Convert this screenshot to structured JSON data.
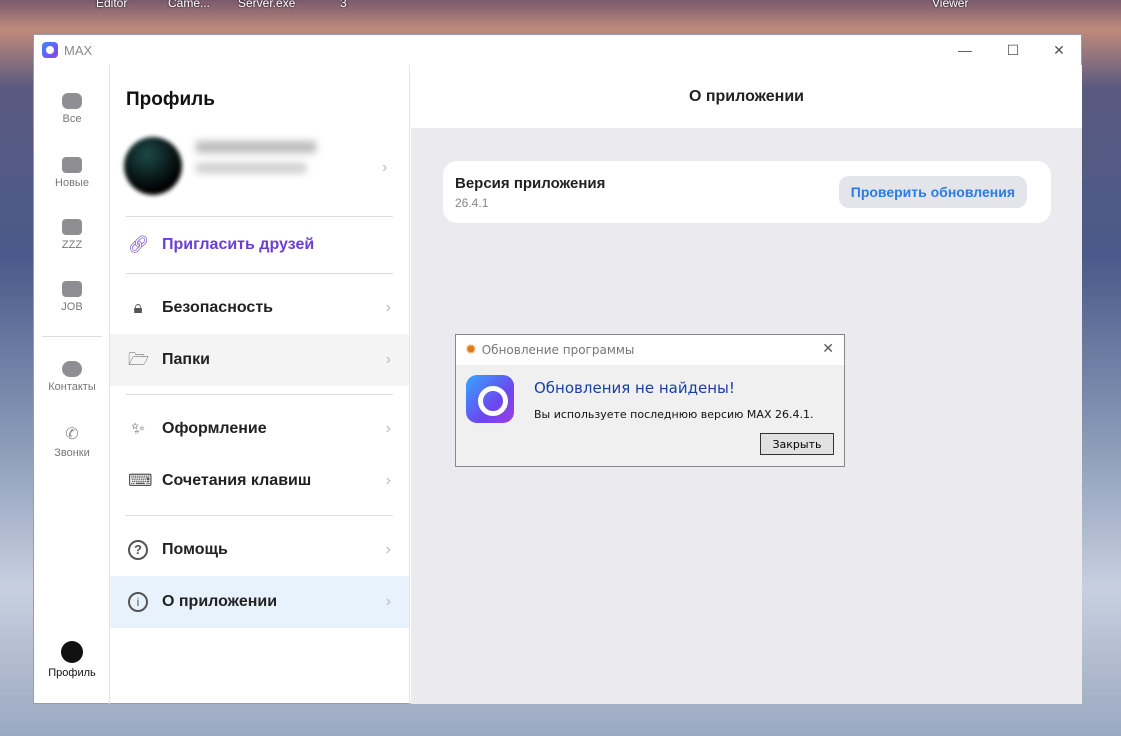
{
  "desktop": {
    "labels": [
      "Editor",
      "Came...",
      "Server.exe",
      "3",
      "Viewer"
    ]
  },
  "window": {
    "title": "MAX",
    "minimize": "—",
    "maximize": "☐",
    "close": "✕"
  },
  "rail": {
    "items": [
      {
        "label": "Все"
      },
      {
        "label": "Новые"
      },
      {
        "label": "ZZZ"
      },
      {
        "label": "JOB"
      },
      {
        "label": "Контакты"
      },
      {
        "label": "Звонки"
      }
    ],
    "profile": "Профиль"
  },
  "settings": {
    "title": "Профиль",
    "invite": "Пригласить друзей",
    "items": [
      "Безопасность",
      "Папки",
      "Оформление",
      "Сочетания клавиш",
      "Помощь",
      "О приложении"
    ],
    "chevron": "›"
  },
  "about": {
    "header": "О приложении",
    "version_label": "Версия приложения",
    "version": "26.4.1",
    "check_button": "Проверить обновления"
  },
  "dialog": {
    "title": "Обновление программы",
    "heading": "Обновления не найдены!",
    "message": "Вы используете последнюю версию MAX 26.4.1.",
    "close_button": "Закрыть",
    "close_icon": "✕"
  },
  "colors": {
    "accent": "#2a7de1",
    "invite": "#6a3fd8",
    "selected": "#e8f2fd"
  }
}
